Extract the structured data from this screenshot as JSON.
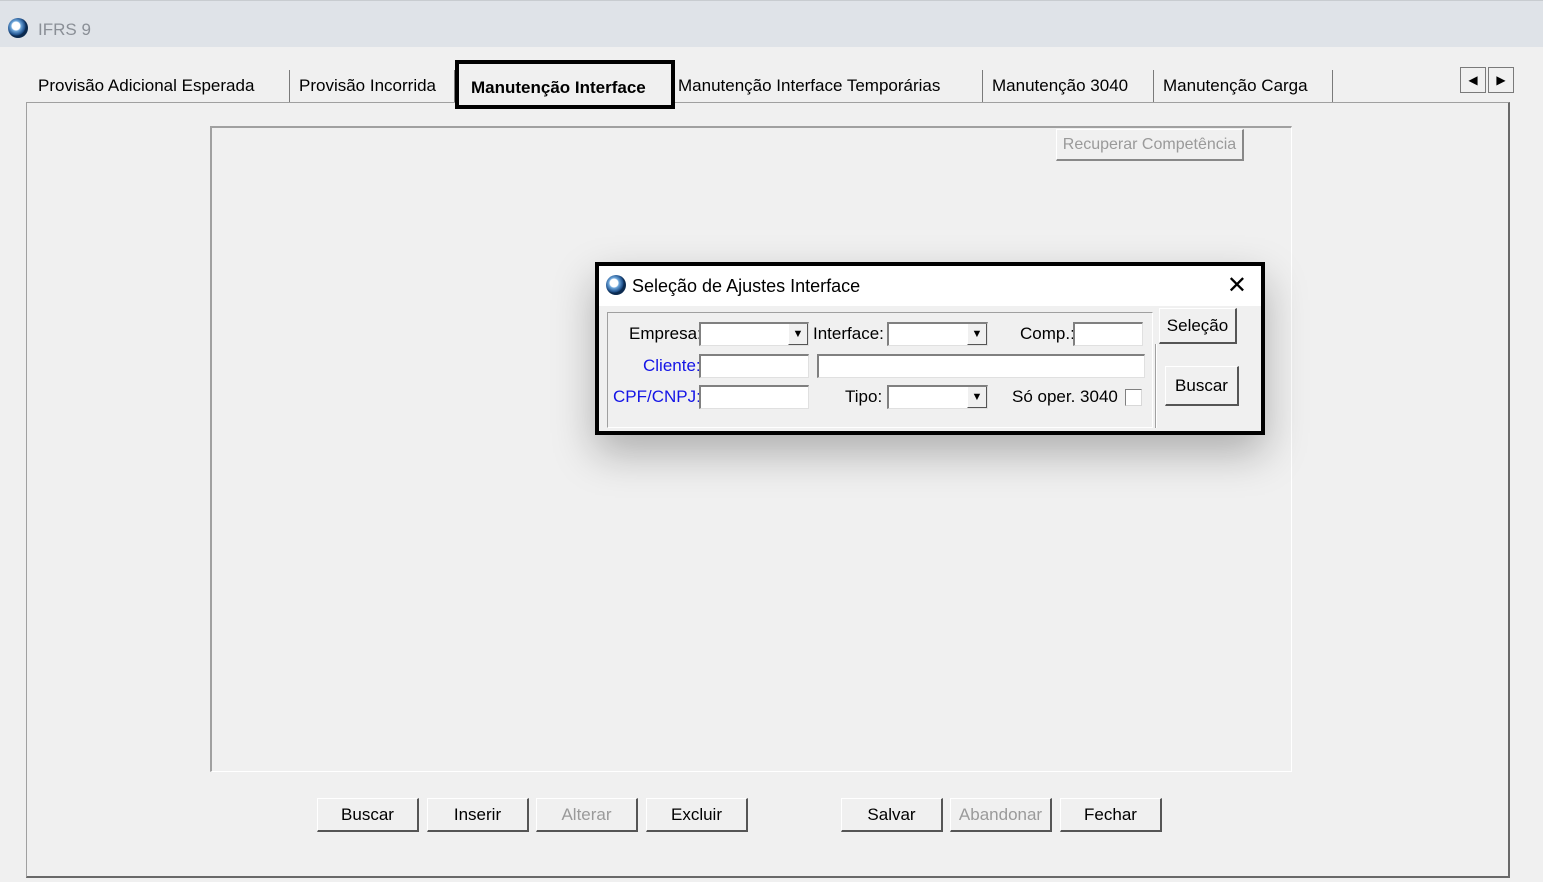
{
  "window": {
    "title": "IFRS 9"
  },
  "tabs": [
    "Provisão Adicional Esperada",
    "Provisão Incorrida",
    "Manutenção Interface",
    "Manutenção Interface Temporárias",
    "Manutenção 3040",
    "Manutenção Carga"
  ],
  "active_tab": "Manutenção Interface",
  "tab_scroll": {
    "left": "◀",
    "right": "▶"
  },
  "panel": {
    "recuperar_label": "Recuperar Competência"
  },
  "dialog": {
    "title": "Seleção de Ajustes Interface",
    "close_glyph": "✕",
    "labels": {
      "empresa": "Empresa:",
      "interface": "Interface:",
      "comp": "Comp.:",
      "cliente": "Cliente:",
      "cpf_cnpj": "CPF/CNPJ:",
      "tipo": "Tipo:",
      "so_oper": "Só oper. 3040"
    },
    "values": {
      "empresa": "",
      "interface": "",
      "comp": "",
      "cliente": "",
      "cliente_nome": "",
      "cpf_cnpj": "",
      "tipo": "",
      "so_oper_checked": false
    },
    "buttons": {
      "selecao": "Seleção",
      "buscar": "Buscar"
    }
  },
  "toolbar": {
    "buscar": "Buscar",
    "inserir": "Inserir",
    "alterar": "Alterar",
    "excluir": "Excluir",
    "salvar": "Salvar",
    "abandonar": "Abandonar",
    "fechar": "Fechar"
  },
  "icons": {
    "app": "app-logo-icon",
    "dropdown": "chevron-down-icon",
    "close": "close-icon"
  },
  "colors": {
    "link_label": "#1414e6",
    "disabled_text": "#9a9a9a",
    "highlight_border": "#000000"
  }
}
